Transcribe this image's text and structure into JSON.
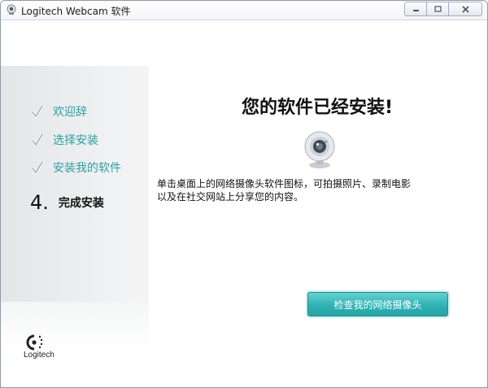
{
  "window": {
    "title": "Logitech Webcam 软件",
    "icons": {
      "app": "webcam-icon",
      "minimize": "minimize-icon",
      "maximize": "maximize-icon",
      "close": "close-icon"
    }
  },
  "sidebar": {
    "completed_steps": [
      {
        "label": "欢迎辞",
        "icon": "checkmark-icon"
      },
      {
        "label": "选择安装",
        "icon": "checkmark-icon"
      },
      {
        "label": "安装我的软件",
        "icon": "checkmark-icon"
      }
    ],
    "current_step": {
      "number": "4.",
      "label": "完成安装"
    },
    "step_color": "#2aa1a4"
  },
  "main": {
    "heading": "您的软件已经安装!",
    "camera_icon": "webcam-icon",
    "description_line1": "单击桌面上的网络摄像头软件图标，可拍摄照片、录制电影",
    "description_line2": "以及在社交网站上分享您的内容。",
    "check_camera_label": "检查我的网络摄像头",
    "button_color": "#2fb2b3"
  },
  "brand": {
    "name": "Logitech",
    "logo_icon": "logitech-logo-icon"
  }
}
